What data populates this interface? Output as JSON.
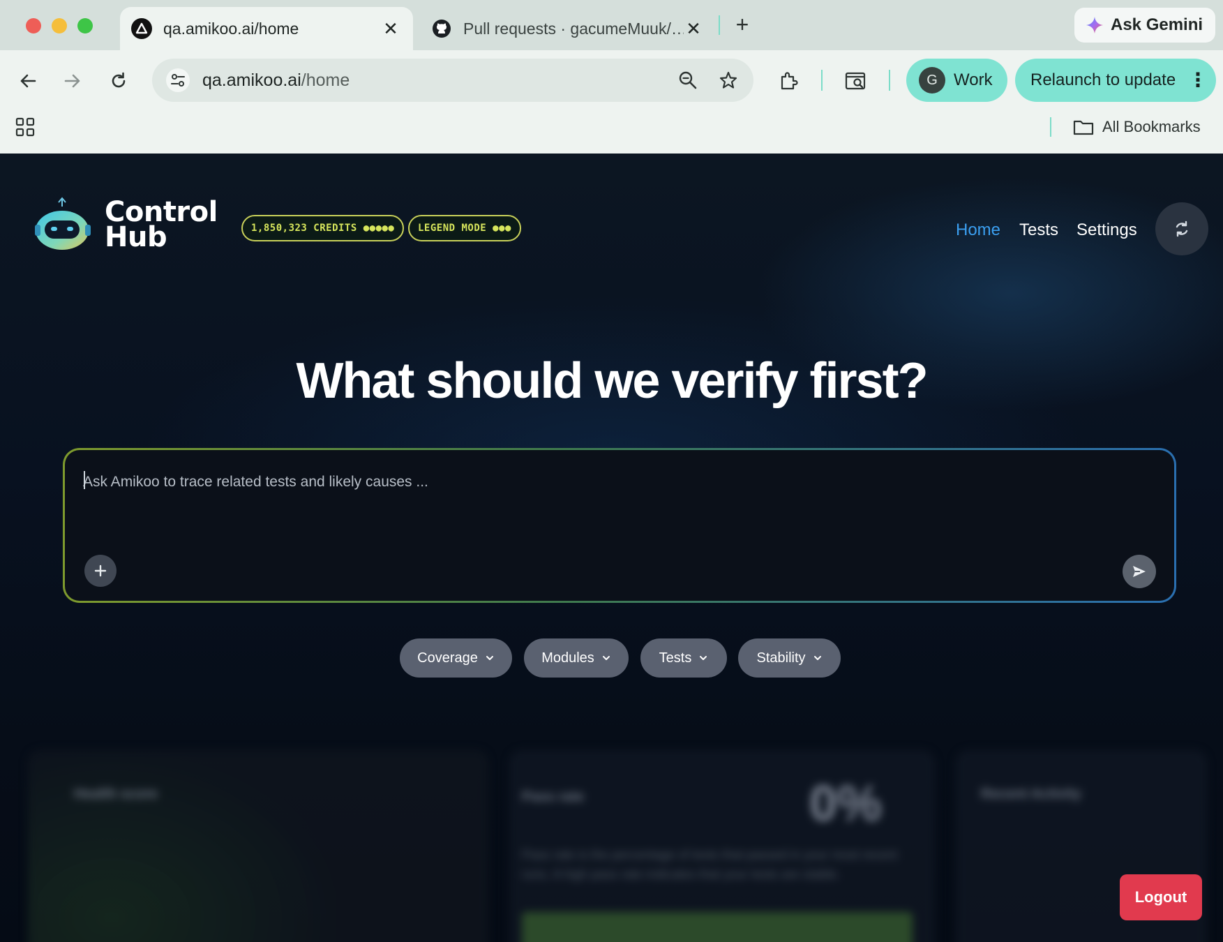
{
  "browser": {
    "tabs": [
      {
        "title": "qa.amikoo.ai/home",
        "active": true,
        "favicon": "amikoo-triangle-icon"
      },
      {
        "title": "Pull requests · gacumeMuuk/…",
        "active": false,
        "favicon": "github-icon"
      }
    ],
    "new_tab_label": "+",
    "ask_gemini_label": "Ask Gemini",
    "address": {
      "host": "qa.amikoo.ai",
      "path": "/home"
    },
    "profile": {
      "initial": "G",
      "label": "Work"
    },
    "relaunch_label": "Relaunch to update",
    "bookmarks": {
      "all_label": "All Bookmarks"
    }
  },
  "app": {
    "brand": {
      "line1": "Control",
      "line2": "Hub"
    },
    "badges": {
      "credits": "1,850,323 CREDITS ●●●●●",
      "mode": "LEGEND MODE ●●●"
    },
    "nav": {
      "home": "Home",
      "tests": "Tests",
      "settings": "Settings",
      "active": "Home"
    },
    "hero_title": "What should we verify first?",
    "prompt": {
      "placeholder": "Ask Amikoo to trace related tests and likely causes ..."
    },
    "chips": [
      "Coverage",
      "Modules",
      "Tests",
      "Stability"
    ],
    "dashboard": {
      "health_label": "Health score",
      "pass_rate_label": "Pass rate",
      "pass_rate_value": "0%",
      "pass_rate_description": "Pass rate is the percentage of tests that passed in your most recent runs. A high pass rate indicates that your tests are stable.",
      "recent_label": "Recent Activity"
    },
    "logout_label": "Logout"
  },
  "colors": {
    "accent_blue": "#3b9ff0",
    "badge_yellow": "#d7e65c",
    "logout_red": "#e13a4e",
    "chrome_teal": "#7fe3d2"
  }
}
